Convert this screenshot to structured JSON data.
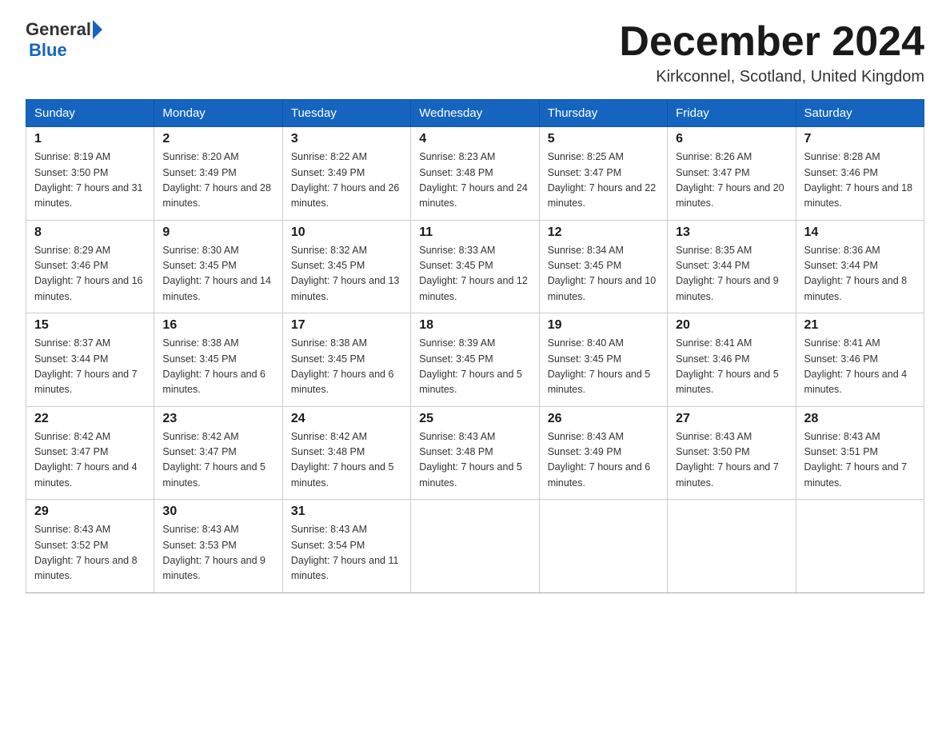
{
  "logo": {
    "general": "General",
    "blue": "Blue"
  },
  "header": {
    "month": "December 2024",
    "location": "Kirkconnel, Scotland, United Kingdom"
  },
  "days_of_week": [
    "Sunday",
    "Monday",
    "Tuesday",
    "Wednesday",
    "Thursday",
    "Friday",
    "Saturday"
  ],
  "weeks": [
    [
      {
        "day": 1,
        "sunrise": "8:19 AM",
        "sunset": "3:50 PM",
        "daylight": "7 hours and 31 minutes."
      },
      {
        "day": 2,
        "sunrise": "8:20 AM",
        "sunset": "3:49 PM",
        "daylight": "7 hours and 28 minutes."
      },
      {
        "day": 3,
        "sunrise": "8:22 AM",
        "sunset": "3:49 PM",
        "daylight": "7 hours and 26 minutes."
      },
      {
        "day": 4,
        "sunrise": "8:23 AM",
        "sunset": "3:48 PM",
        "daylight": "7 hours and 24 minutes."
      },
      {
        "day": 5,
        "sunrise": "8:25 AM",
        "sunset": "3:47 PM",
        "daylight": "7 hours and 22 minutes."
      },
      {
        "day": 6,
        "sunrise": "8:26 AM",
        "sunset": "3:47 PM",
        "daylight": "7 hours and 20 minutes."
      },
      {
        "day": 7,
        "sunrise": "8:28 AM",
        "sunset": "3:46 PM",
        "daylight": "7 hours and 18 minutes."
      }
    ],
    [
      {
        "day": 8,
        "sunrise": "8:29 AM",
        "sunset": "3:46 PM",
        "daylight": "7 hours and 16 minutes."
      },
      {
        "day": 9,
        "sunrise": "8:30 AM",
        "sunset": "3:45 PM",
        "daylight": "7 hours and 14 minutes."
      },
      {
        "day": 10,
        "sunrise": "8:32 AM",
        "sunset": "3:45 PM",
        "daylight": "7 hours and 13 minutes."
      },
      {
        "day": 11,
        "sunrise": "8:33 AM",
        "sunset": "3:45 PM",
        "daylight": "7 hours and 12 minutes."
      },
      {
        "day": 12,
        "sunrise": "8:34 AM",
        "sunset": "3:45 PM",
        "daylight": "7 hours and 10 minutes."
      },
      {
        "day": 13,
        "sunrise": "8:35 AM",
        "sunset": "3:44 PM",
        "daylight": "7 hours and 9 minutes."
      },
      {
        "day": 14,
        "sunrise": "8:36 AM",
        "sunset": "3:44 PM",
        "daylight": "7 hours and 8 minutes."
      }
    ],
    [
      {
        "day": 15,
        "sunrise": "8:37 AM",
        "sunset": "3:44 PM",
        "daylight": "7 hours and 7 minutes."
      },
      {
        "day": 16,
        "sunrise": "8:38 AM",
        "sunset": "3:45 PM",
        "daylight": "7 hours and 6 minutes."
      },
      {
        "day": 17,
        "sunrise": "8:38 AM",
        "sunset": "3:45 PM",
        "daylight": "7 hours and 6 minutes."
      },
      {
        "day": 18,
        "sunrise": "8:39 AM",
        "sunset": "3:45 PM",
        "daylight": "7 hours and 5 minutes."
      },
      {
        "day": 19,
        "sunrise": "8:40 AM",
        "sunset": "3:45 PM",
        "daylight": "7 hours and 5 minutes."
      },
      {
        "day": 20,
        "sunrise": "8:41 AM",
        "sunset": "3:46 PM",
        "daylight": "7 hours and 5 minutes."
      },
      {
        "day": 21,
        "sunrise": "8:41 AM",
        "sunset": "3:46 PM",
        "daylight": "7 hours and 4 minutes."
      }
    ],
    [
      {
        "day": 22,
        "sunrise": "8:42 AM",
        "sunset": "3:47 PM",
        "daylight": "7 hours and 4 minutes."
      },
      {
        "day": 23,
        "sunrise": "8:42 AM",
        "sunset": "3:47 PM",
        "daylight": "7 hours and 5 minutes."
      },
      {
        "day": 24,
        "sunrise": "8:42 AM",
        "sunset": "3:48 PM",
        "daylight": "7 hours and 5 minutes."
      },
      {
        "day": 25,
        "sunrise": "8:43 AM",
        "sunset": "3:48 PM",
        "daylight": "7 hours and 5 minutes."
      },
      {
        "day": 26,
        "sunrise": "8:43 AM",
        "sunset": "3:49 PM",
        "daylight": "7 hours and 6 minutes."
      },
      {
        "day": 27,
        "sunrise": "8:43 AM",
        "sunset": "3:50 PM",
        "daylight": "7 hours and 7 minutes."
      },
      {
        "day": 28,
        "sunrise": "8:43 AM",
        "sunset": "3:51 PM",
        "daylight": "7 hours and 7 minutes."
      }
    ],
    [
      {
        "day": 29,
        "sunrise": "8:43 AM",
        "sunset": "3:52 PM",
        "daylight": "7 hours and 8 minutes."
      },
      {
        "day": 30,
        "sunrise": "8:43 AM",
        "sunset": "3:53 PM",
        "daylight": "7 hours and 9 minutes."
      },
      {
        "day": 31,
        "sunrise": "8:43 AM",
        "sunset": "3:54 PM",
        "daylight": "7 hours and 11 minutes."
      },
      null,
      null,
      null,
      null
    ]
  ]
}
